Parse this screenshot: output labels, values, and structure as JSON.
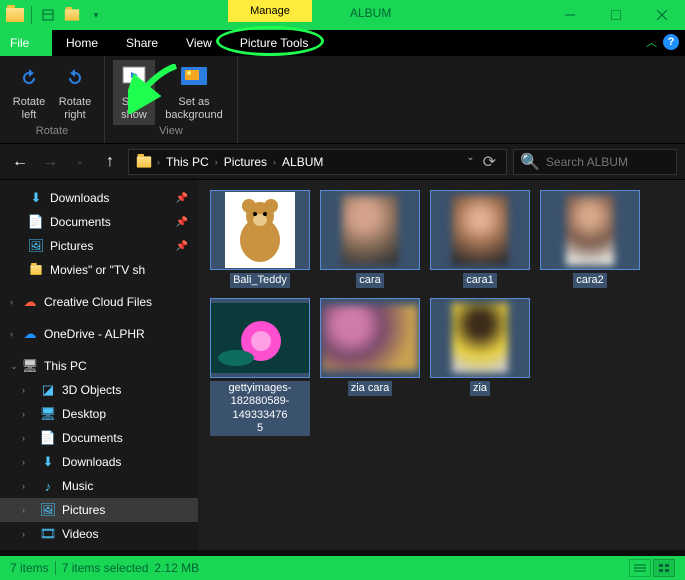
{
  "title": "ALBUM",
  "manage_label": "Manage",
  "menu": {
    "file": "File",
    "home": "Home",
    "share": "Share",
    "view": "View",
    "picture_tools": "Picture Tools"
  },
  "ribbon": {
    "rotate_left": "Rotate\nleft",
    "rotate_right": "Rotate\nright",
    "slide_show": "Slide\nshow",
    "set_bg": "Set as\nbackground",
    "group_rotate": "Rotate",
    "group_view": "View"
  },
  "breadcrumb": [
    "This PC",
    "Pictures",
    "ALBUM"
  ],
  "search_placeholder": "Search ALBUM",
  "sidebar": {
    "quick": [
      {
        "label": "Downloads",
        "icon": "download",
        "pin": true
      },
      {
        "label": "Documents",
        "icon": "doc",
        "pin": true
      },
      {
        "label": "Pictures",
        "icon": "pic",
        "pin": true
      },
      {
        "label": "Movies\" or \"TV sh",
        "icon": "folder",
        "pin": false
      }
    ],
    "creative": "Creative Cloud Files",
    "onedrive": "OneDrive - ALPHR",
    "thispc": "This PC",
    "thispc_items": [
      {
        "label": "3D Objects",
        "icon": "3d"
      },
      {
        "label": "Desktop",
        "icon": "desktop"
      },
      {
        "label": "Documents",
        "icon": "doc"
      },
      {
        "label": "Downloads",
        "icon": "download"
      },
      {
        "label": "Music",
        "icon": "music"
      },
      {
        "label": "Pictures",
        "icon": "pic",
        "sel": true
      },
      {
        "label": "Videos",
        "icon": "video"
      }
    ]
  },
  "files": [
    {
      "name": "Bali_Teddy",
      "type": "teddy"
    },
    {
      "name": "cara",
      "type": "blur"
    },
    {
      "name": "cara1",
      "type": "blur"
    },
    {
      "name": "cara2",
      "type": "blur"
    },
    {
      "name": "gettyimages-182880589-149333476\n5",
      "type": "lotus"
    },
    {
      "name": "zia cara",
      "type": "blur-grp"
    },
    {
      "name": "zia",
      "type": "blur-y"
    }
  ],
  "status": {
    "items": "7 items",
    "selected": "7 items selected",
    "size": "2.12 MB"
  }
}
